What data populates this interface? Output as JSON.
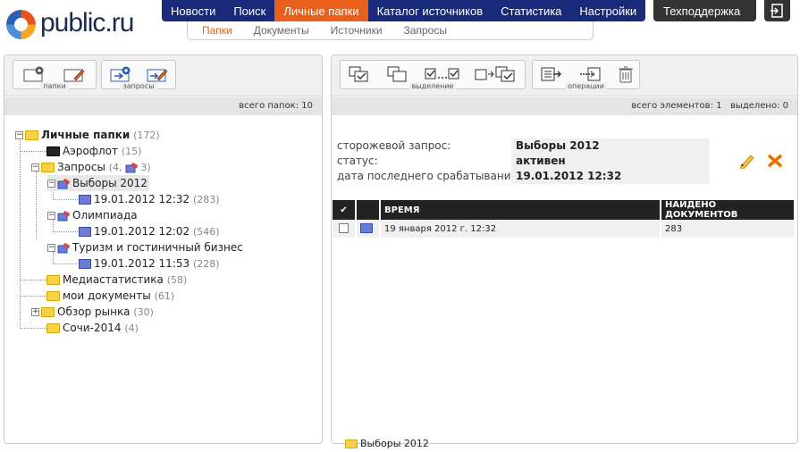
{
  "logo": {
    "text": "public.ru"
  },
  "topnav": {
    "items": [
      {
        "label": "Новости"
      },
      {
        "label": "Поиск"
      },
      {
        "label": "Личные папки"
      },
      {
        "label": "Каталог источников"
      },
      {
        "label": "Статистика"
      },
      {
        "label": "Настройки"
      }
    ],
    "active": "Личные папки",
    "support": "Техподдержка"
  },
  "subnav": {
    "items": [
      {
        "label": "Папки"
      },
      {
        "label": "Документы"
      },
      {
        "label": "Источники"
      },
      {
        "label": "Запросы"
      }
    ],
    "active": "Папки"
  },
  "left": {
    "groups": [
      {
        "label": "папки"
      },
      {
        "label": "запросы"
      }
    ],
    "count_text": "всего папок: 10",
    "tree": {
      "root": {
        "label": "Личные папки",
        "count": "(172)"
      },
      "aeroflot": {
        "label": "Аэрофлот",
        "count": "(15)"
      },
      "queries": {
        "label": "Запросы",
        "count": "(4,",
        "count2": "3)"
      },
      "q1": {
        "label": "Выборы 2012",
        "date": "19.01.2012 12:32",
        "count": "(283)"
      },
      "q2": {
        "label": "Олимпиада",
        "date": "19.01.2012 12:02",
        "count": "(546)"
      },
      "q3": {
        "label": "Туризм и гостиничный бизнес",
        "date": "19.01.2012 11:53",
        "count": "(228)"
      },
      "media": {
        "label": "Медиастатистика",
        "count": "(58)"
      },
      "mydocs": {
        "label": "мои документы",
        "count": "(61)"
      },
      "market": {
        "label": "Обзор рынка",
        "count": "(30)"
      },
      "sochi": {
        "label": "Сочи-2014",
        "count": "(4)"
      }
    }
  },
  "right": {
    "groups": [
      {
        "label": "выделение"
      },
      {
        "label": "операции"
      }
    ],
    "total": "всего элементов: 1",
    "selected": "выделено: 0",
    "info": {
      "query_label": "сторожевой запрос:",
      "query_value": "Выборы 2012",
      "status_label": "статус:",
      "status_value": "активен",
      "date_label": "дата последнего срабатывания:",
      "date_value": "19.01.2012 12:32"
    },
    "table": {
      "headers": {
        "check": "✔",
        "time": "ВРЕМЯ",
        "found": "НАЙДЕНО ДОКУМЕНТОВ"
      },
      "rows": [
        {
          "time": "19 января 2012 г. 12:32",
          "found": "283"
        }
      ]
    },
    "status_folder": "Выборы 2012"
  },
  "colors": {
    "nav_bg": "#1a2a7a",
    "active": "#e8601c",
    "support_bg": "#333333"
  }
}
